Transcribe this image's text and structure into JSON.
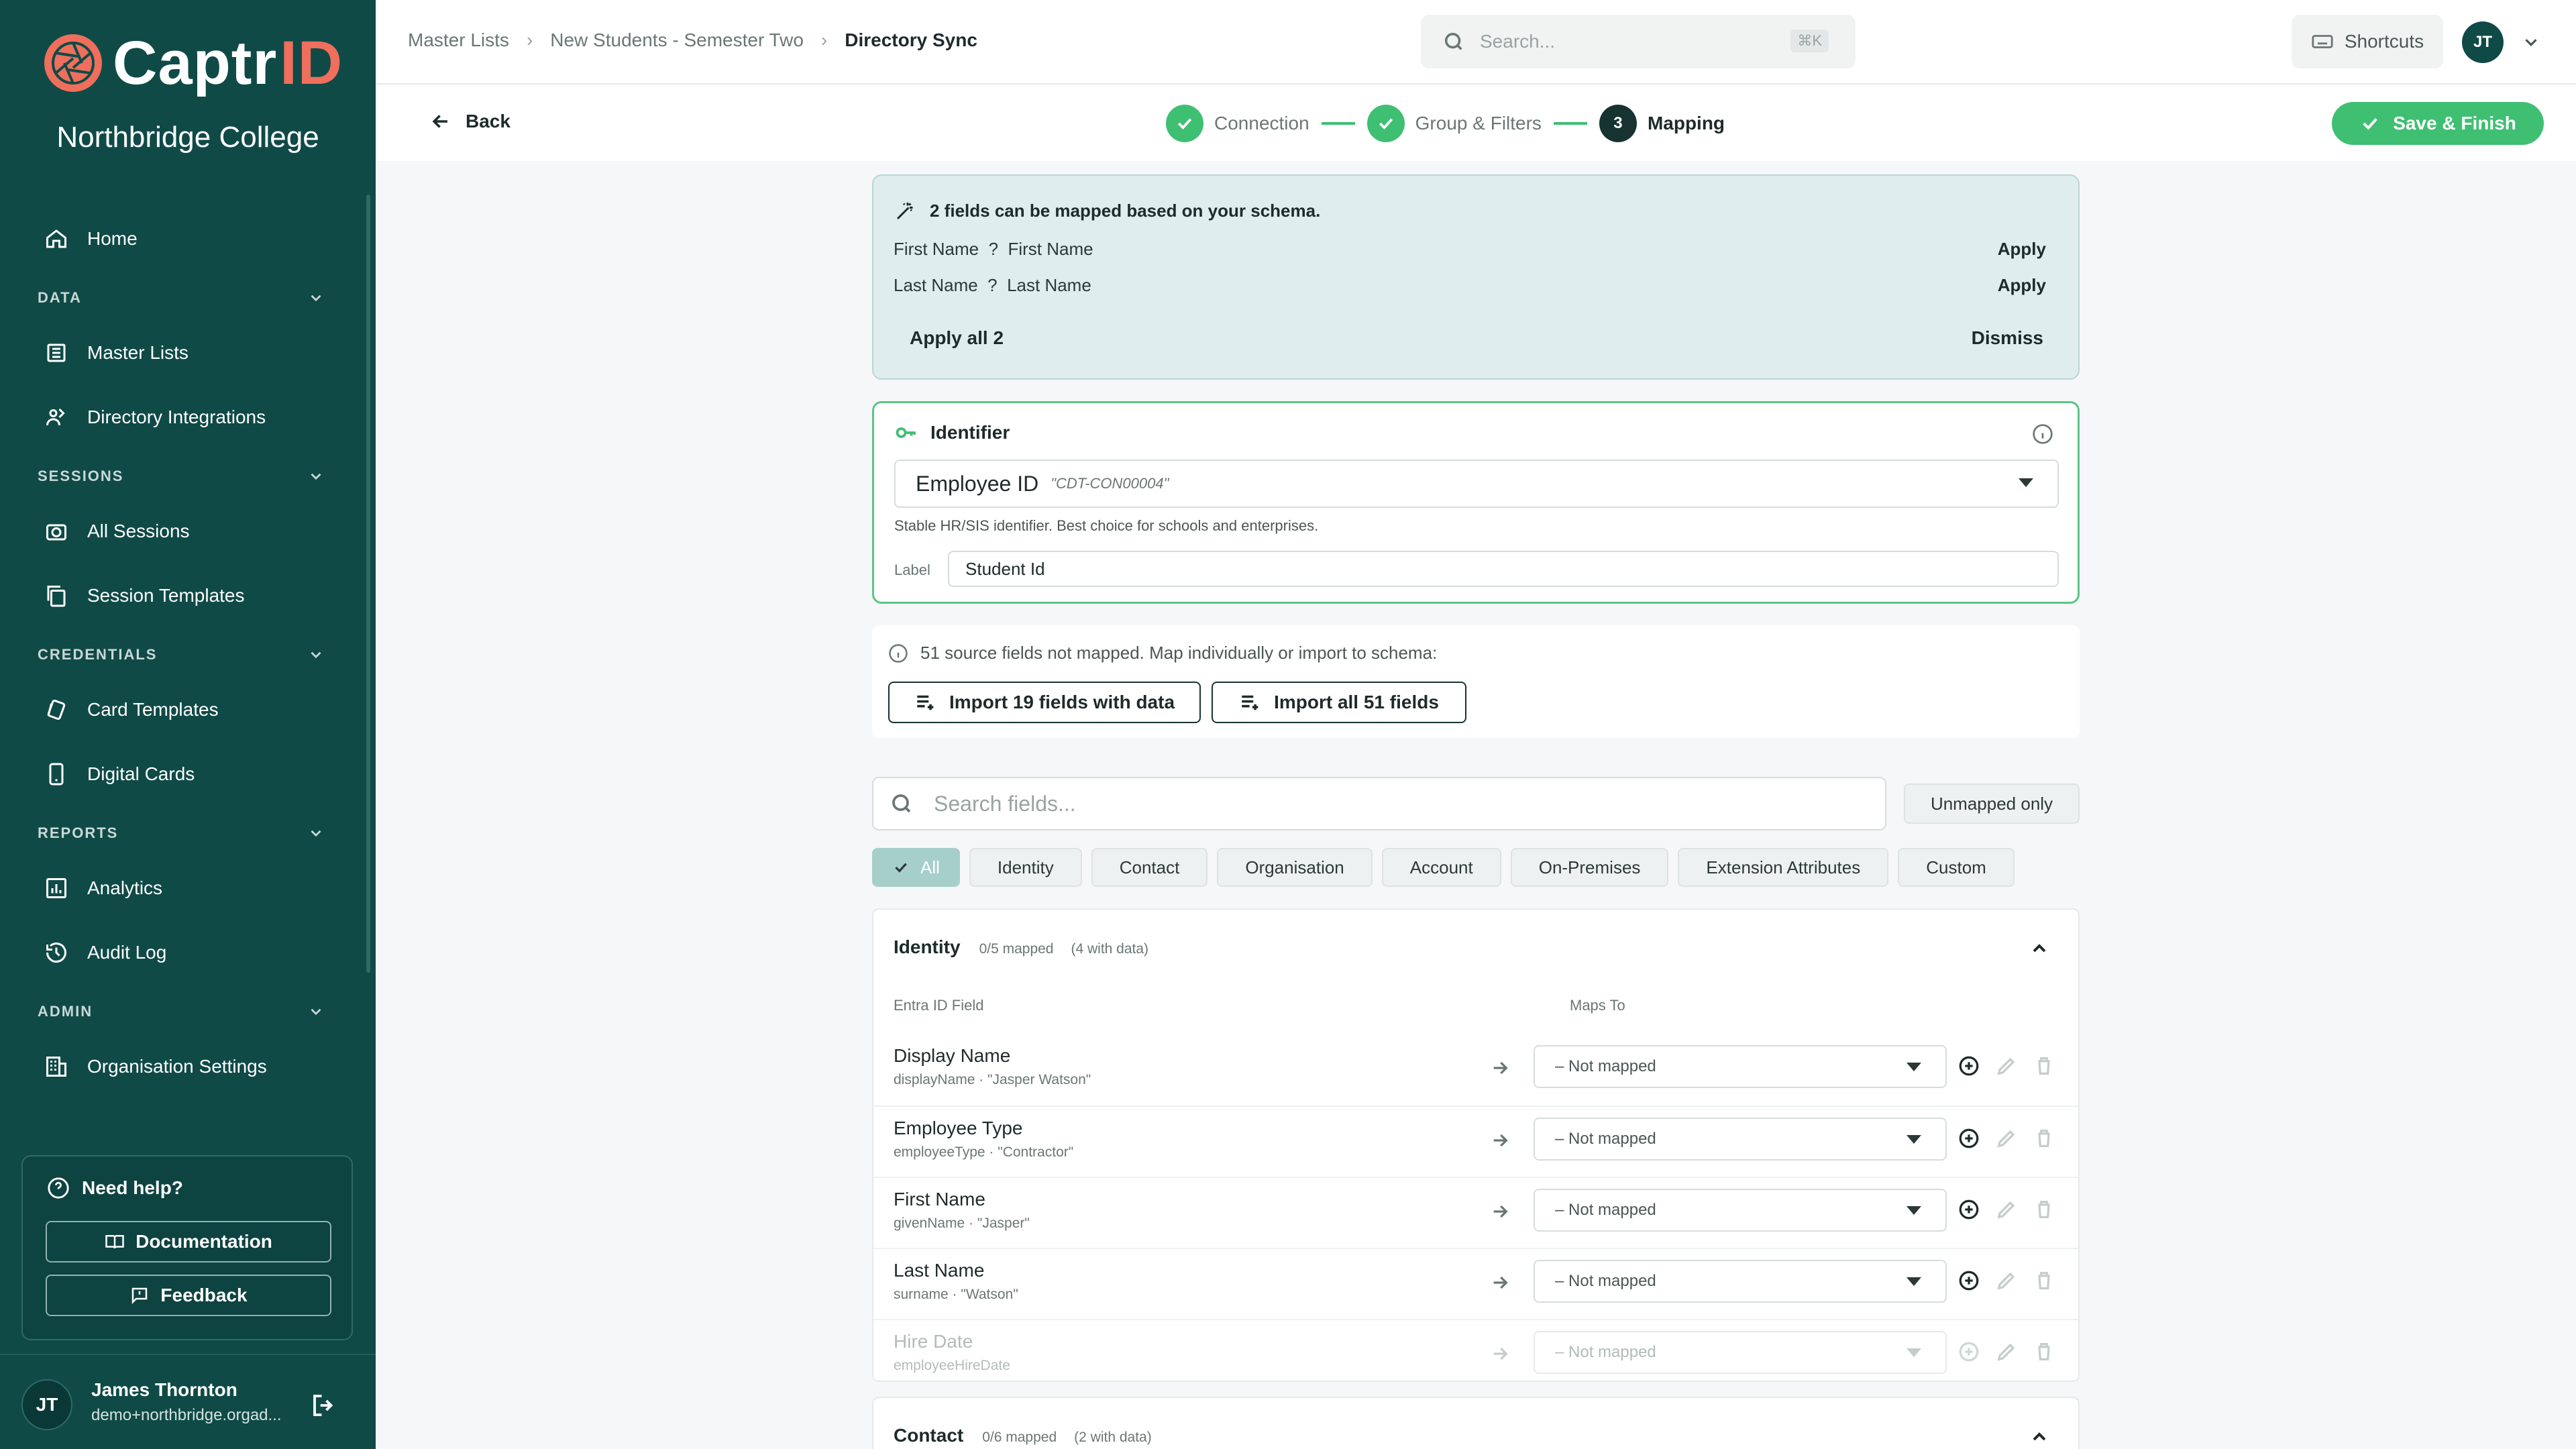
{
  "brand": {
    "name_part1": "Captr",
    "name_part2": "ID",
    "org": "Northbridge College",
    "accent": "#ef6f5c",
    "sidebar_bg": "#0f4a47"
  },
  "sidebar": {
    "top_item": {
      "label": "Home",
      "icon": "home-icon"
    },
    "sections": [
      {
        "title": "DATA",
        "items": [
          {
            "label": "Master Lists",
            "icon": "list-icon"
          },
          {
            "label": "Directory Integrations",
            "icon": "directory-icon"
          }
        ]
      },
      {
        "title": "SESSIONS",
        "items": [
          {
            "label": "All Sessions",
            "icon": "camera-icon"
          },
          {
            "label": "Session Templates",
            "icon": "copy-icon"
          }
        ]
      },
      {
        "title": "CREDENTIALS",
        "items": [
          {
            "label": "Card Templates",
            "icon": "cards-icon"
          },
          {
            "label": "Digital Cards",
            "icon": "phone-icon"
          }
        ]
      },
      {
        "title": "REPORTS",
        "items": [
          {
            "label": "Analytics",
            "icon": "chart-icon"
          },
          {
            "label": "Audit Log",
            "icon": "history-icon"
          }
        ]
      },
      {
        "title": "ADMIN",
        "items": [
          {
            "label": "Organisation Settings",
            "icon": "building-icon"
          }
        ]
      }
    ],
    "help": {
      "title": "Need help?",
      "documentation": "Documentation",
      "feedback": "Feedback"
    },
    "user": {
      "initials": "JT",
      "name": "James Thornton",
      "email": "demo+northbridge.orgad..."
    }
  },
  "topbar": {
    "breadcrumb": [
      "Master Lists",
      "New Students - Semester Two",
      "Directory Sync"
    ],
    "search_placeholder": "Search...",
    "search_shortcut": "⌘K",
    "shortcuts_label": "Shortcuts",
    "avatar_initials": "JT"
  },
  "stepbar": {
    "back_label": "Back",
    "steps": [
      {
        "label": "Connection",
        "state": "done"
      },
      {
        "label": "Group & Filters",
        "state": "done"
      },
      {
        "label": "Mapping",
        "state": "current",
        "number": "3"
      }
    ],
    "save_label": "Save & Finish",
    "accent": "#3fbf72"
  },
  "suggestions": {
    "title": "2 fields can be mapped based on your schema.",
    "rows": [
      {
        "text": "First Name  ?  First Name",
        "action": "Apply"
      },
      {
        "text": "Last Name  ?  Last Name",
        "action": "Apply"
      }
    ],
    "apply_all": "Apply all 2",
    "dismiss": "Dismiss"
  },
  "identifier": {
    "title": "Identifier",
    "selected": "Employee ID",
    "sample": "\"CDT-CON00004\"",
    "hint": "Stable HR/SIS identifier. Best choice for schools and enterprises.",
    "label_caption": "Label",
    "label_value": "Student Id"
  },
  "unmapped": {
    "text": "51 source fields not mapped. Map individually or import to schema:",
    "import_with_data": "Import 19 fields with data",
    "import_all": "Import all 51 fields"
  },
  "filter": {
    "search_placeholder": "Search fields...",
    "unmapped_only": "Unmapped only",
    "chips": [
      "All",
      "Identity",
      "Contact",
      "Organisation",
      "Account",
      "On-Premises",
      "Extension Attributes",
      "Custom"
    ],
    "active_chip": "All"
  },
  "groups": [
    {
      "title": "Identity",
      "mapped": "0/5 mapped",
      "with_data": "(4 with data)",
      "col_source": "Entra ID Field",
      "col_target": "Maps To",
      "fields": [
        {
          "name": "Display Name",
          "sub": "displayName · \"Jasper Watson\"",
          "value": "– Not mapped",
          "disabled": false
        },
        {
          "name": "Employee Type",
          "sub": "employeeType · \"Contractor\"",
          "value": "– Not mapped",
          "disabled": false
        },
        {
          "name": "First Name",
          "sub": "givenName · \"Jasper\"",
          "value": "– Not mapped",
          "disabled": false
        },
        {
          "name": "Last Name",
          "sub": "surname · \"Watson\"",
          "value": "– Not mapped",
          "disabled": false
        },
        {
          "name": "Hire Date",
          "sub": "employeeHireDate",
          "value": "– Not mapped",
          "disabled": true
        }
      ]
    },
    {
      "title": "Contact",
      "mapped": "0/6 mapped",
      "with_data": "(2 with data)"
    }
  ]
}
